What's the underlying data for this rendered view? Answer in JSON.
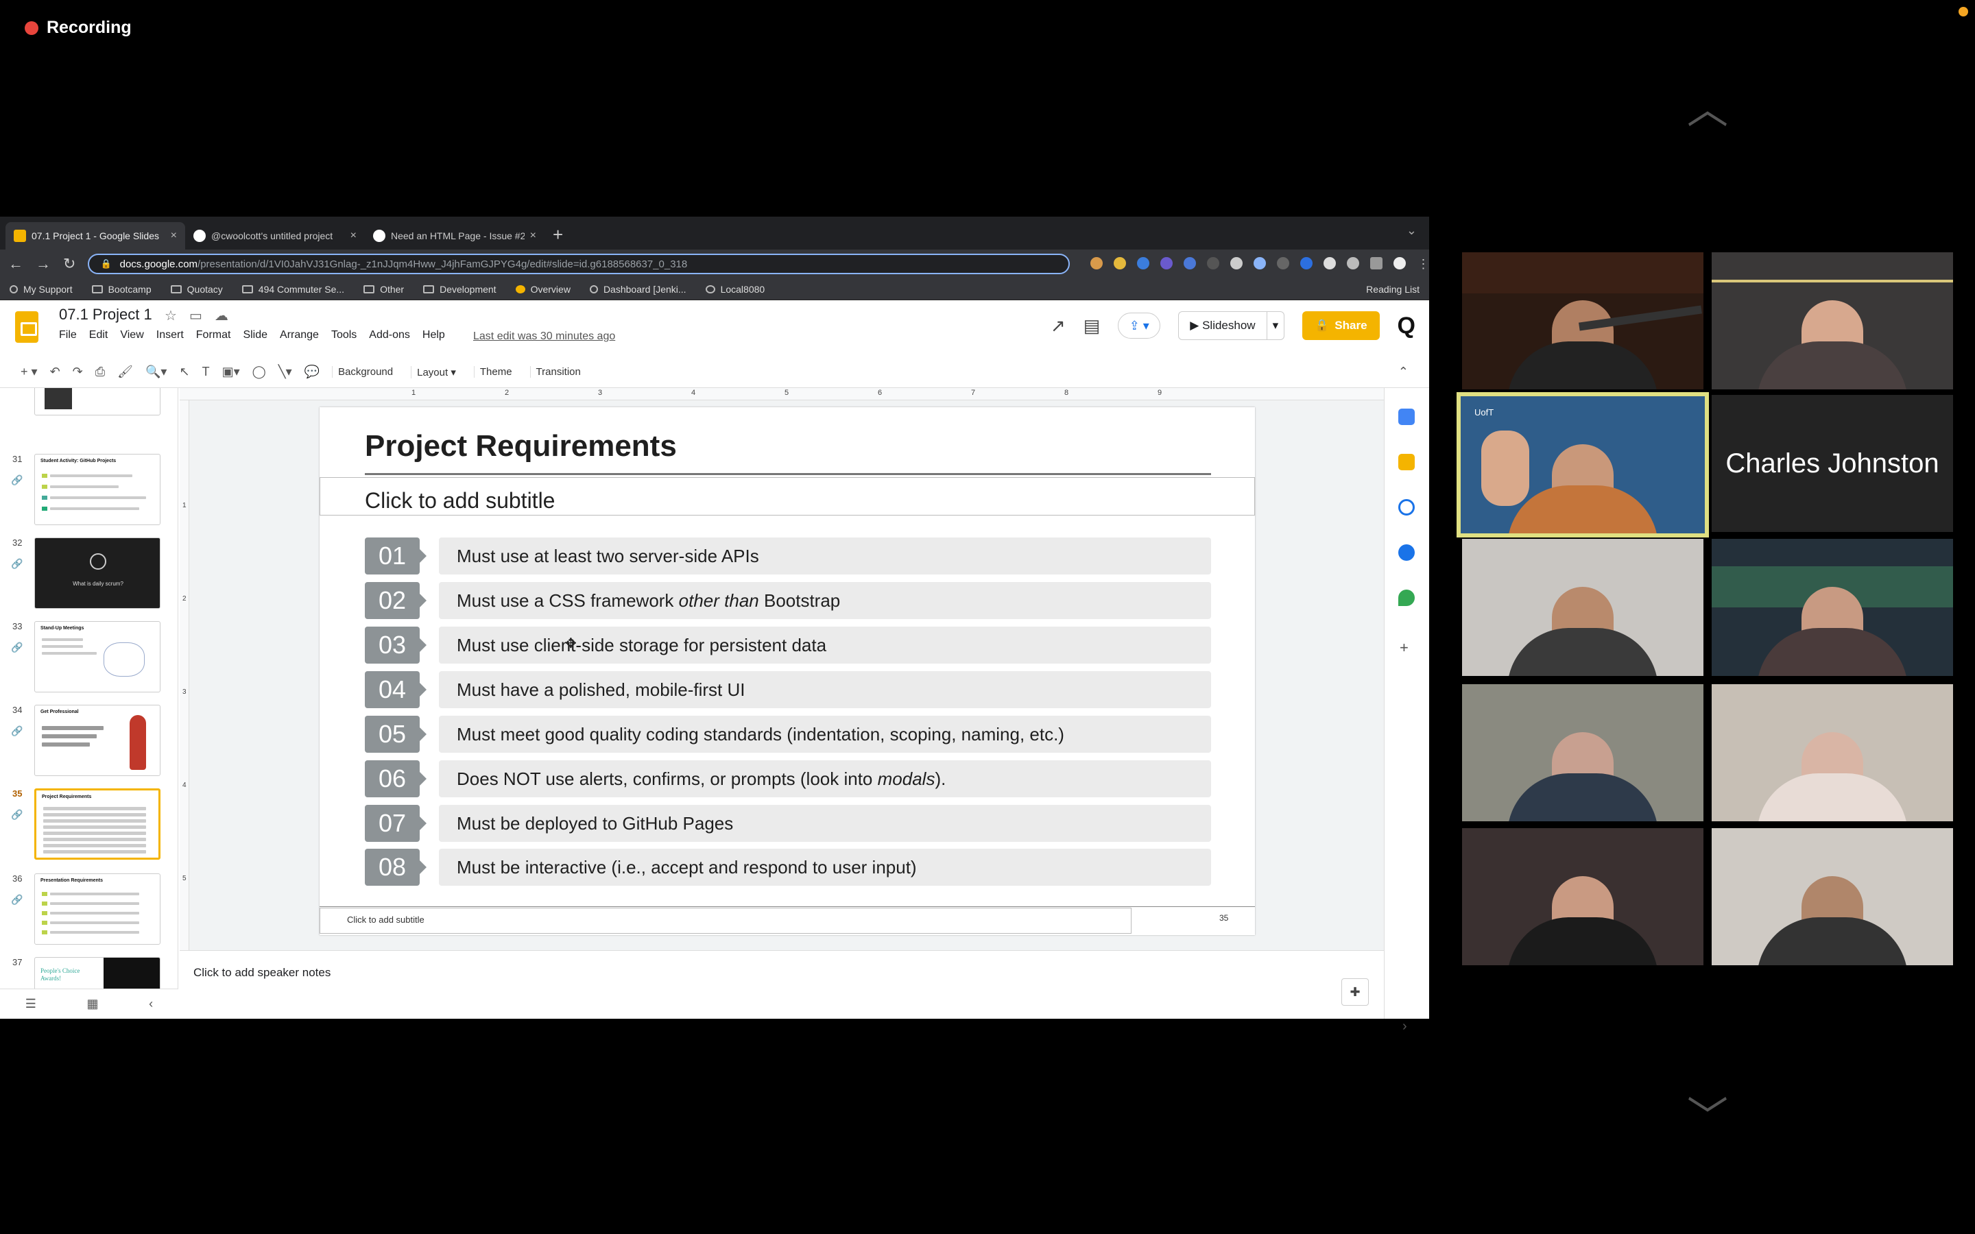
{
  "recording": {
    "label": "Recording"
  },
  "browser": {
    "tabs": [
      {
        "label": "07.1 Project 1 - Google Slides",
        "close": "×"
      },
      {
        "label": "@cwoolcott's untitled project",
        "close": "×"
      },
      {
        "label": "Need an HTML Page - Issue #2",
        "close": "×"
      }
    ],
    "new_tab": "+",
    "url_host": "docs.google.com",
    "url_path": "/presentation/d/1VI0JahVJ31Gnlag-_z1nJJqm4Hww_J4jhFamGJPYG4g/edit#slide=id.g6188568637_0_318",
    "bookmarks": [
      "My Support",
      "Bootcamp",
      "Quotacy",
      "494 Commuter Se...",
      "Other",
      "Development",
      "Overview",
      "Dashboard [Jenki...",
      "Local8080"
    ],
    "reading_list": "Reading List"
  },
  "app": {
    "doc_title": "07.1 Project 1",
    "menus": [
      "File",
      "Edit",
      "View",
      "Insert",
      "Format",
      "Slide",
      "Arrange",
      "Tools",
      "Add-ons",
      "Help"
    ],
    "last_edit": "Last edit was 30 minutes ago",
    "slideshow": "Slideshow",
    "share": "Share",
    "toolbar_text": [
      "Background",
      "Layout ▾",
      "Theme",
      "Transition"
    ]
  },
  "filmstrip": [
    {
      "num": "31",
      "title": "Student Activity: GitHub Projects"
    },
    {
      "num": "32",
      "title": "What is daily scrum?"
    },
    {
      "num": "33",
      "title": "Stand-Up Meetings"
    },
    {
      "num": "34",
      "title": "Get Professional"
    },
    {
      "num": "35",
      "title": "Project Requirements"
    },
    {
      "num": "36",
      "title": "Presentation Requirements"
    },
    {
      "num": "37",
      "title": "People's Choice Awards!"
    }
  ],
  "slide": {
    "title": "Project Requirements",
    "subtitle": "Click to add subtitle",
    "requirements": [
      {
        "num": "01",
        "text": "Must use at least two server-side APIs"
      },
      {
        "num": "02",
        "pre": "Must use a CSS framework ",
        "em": "other than",
        "post": " Bootstrap"
      },
      {
        "num": "03",
        "text": "Must use client-side storage for persistent data"
      },
      {
        "num": "04",
        "text": "Must have a polished, mobile-first UI"
      },
      {
        "num": "05",
        "text": "Must meet good quality coding standards (indentation, scoping, naming, etc.)"
      },
      {
        "num": "06",
        "pre": "Does NOT use alerts, confirms, or prompts (look into ",
        "em": "modals",
        "post": ")."
      },
      {
        "num": "07",
        "text": "Must be deployed to GitHub Pages"
      },
      {
        "num": "08",
        "text": "Must be interactive (i.e., accept and respond to user input)"
      }
    ],
    "footer_subtitle": "Click to add subtitle",
    "page_number": "35"
  },
  "notes": {
    "placeholder": "Click to add speaker notes"
  },
  "ruler": {
    "h": [
      "1",
      "2",
      "3",
      "4",
      "5",
      "6",
      "7",
      "8",
      "9"
    ],
    "v": [
      "1",
      "2",
      "3",
      "4",
      "5"
    ]
  },
  "participants": {
    "named_tile": "Charles Johnston"
  }
}
